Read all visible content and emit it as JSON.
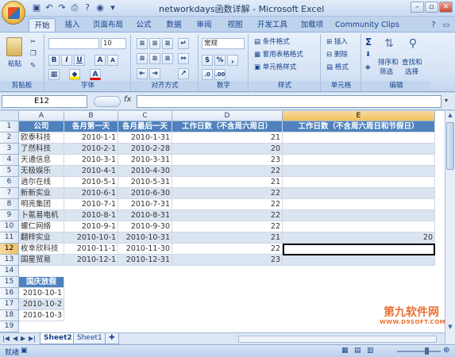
{
  "window": {
    "title": "networkdays函数详解 - Microsoft Excel"
  },
  "qat": {
    "save_icon": "save-icon",
    "undo_icon": "undo-icon",
    "redo_icon": "redo-icon"
  },
  "tabs": [
    "开始",
    "插入",
    "页面布局",
    "公式",
    "数据",
    "审阅",
    "视图",
    "开发工具",
    "加载项",
    "Community Clips"
  ],
  "ribbon": {
    "clipboard": {
      "paste": "粘贴",
      "label": "剪贴板"
    },
    "font": {
      "name_value": "",
      "size_value": "10",
      "bold": "B",
      "italic": "I",
      "underline": "U",
      "grow": "A",
      "shrink": "A",
      "color": "A",
      "label": "字体"
    },
    "alignment": {
      "label": "对齐方式"
    },
    "number": {
      "format_value": "常规",
      "label": "数字"
    },
    "styles": {
      "conditional": "条件格式",
      "table": "套用表格格式",
      "cell": "单元格样式",
      "label": "样式"
    },
    "cells": {
      "insert": "插入",
      "delete": "删除",
      "format": "格式",
      "label": "单元格"
    },
    "editing": {
      "sum": "Σ",
      "sort": "排序和",
      "sort2": "筛选",
      "find": "查找和",
      "find2": "选择",
      "label": "编辑"
    }
  },
  "formula_bar": {
    "name_box": "E12",
    "fx": "fx",
    "formula": ""
  },
  "columns": [
    "A",
    "B",
    "C",
    "D",
    "E"
  ],
  "rows": [
    "1",
    "2",
    "3",
    "4",
    "5",
    "6",
    "7",
    "8",
    "9",
    "10",
    "11",
    "12",
    "13",
    "14",
    "15",
    "16",
    "17",
    "18",
    "19"
  ],
  "table": {
    "headers": [
      "公司",
      "各月第一天",
      "各月最后一天",
      "工作日数（不含周六周日）",
      "工作日数（不含周六周日和节假日）"
    ],
    "rows": [
      [
        "欧泰科技",
        "2010-1-1",
        "2010-1-31",
        "21",
        ""
      ],
      [
        "了然科技",
        "2010-2-1",
        "2010-2-28",
        "20",
        ""
      ],
      [
        "天通信息",
        "2010-3-1",
        "2010-3-31",
        "23",
        ""
      ],
      [
        "无极娱乐",
        "2010-4-1",
        "2010-4-30",
        "22",
        ""
      ],
      [
        "逍尔在线",
        "2010-5-1",
        "2010-5-31",
        "21",
        ""
      ],
      [
        "新新实业",
        "2010-6-1",
        "2010-6-30",
        "22",
        ""
      ],
      [
        "明亮集团",
        "2010-7-1",
        "2010-7-31",
        "22",
        ""
      ],
      [
        "卜氪易电机",
        "2010-8-1",
        "2010-8-31",
        "22",
        ""
      ],
      [
        "螺仁网络",
        "2010-9-1",
        "2010-9-30",
        "22",
        ""
      ],
      [
        "翻梓实业",
        "2010-10-1",
        "2010-10-31",
        "21",
        "20"
      ],
      [
        "枚幸欣科技",
        "2010-11-1",
        "2010-11-30",
        "22",
        ""
      ],
      [
        "国星贸易",
        "2010-12-1",
        "2010-12-31",
        "23",
        ""
      ]
    ]
  },
  "holidays": {
    "header": "国庆放假",
    "dates": [
      "2010-10-1",
      "2010-10-2",
      "2010-10-3"
    ]
  },
  "sheets": [
    "Sheet2",
    "Sheet1"
  ],
  "status": {
    "ready": "就绪"
  },
  "watermark": {
    "main": "第九软件网",
    "sub": "WWW.D9SOFT.COM"
  }
}
